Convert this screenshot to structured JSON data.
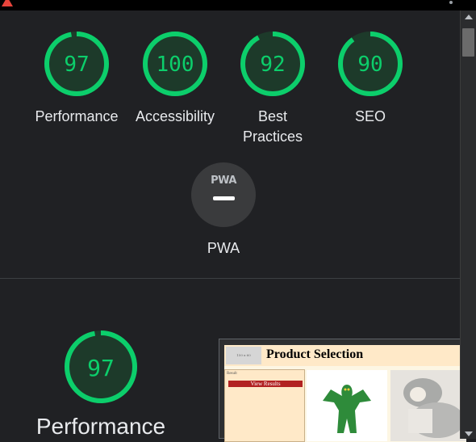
{
  "gauges": [
    {
      "score": "97",
      "label": "Performance",
      "color": "#0cce6b"
    },
    {
      "score": "100",
      "label": "Accessibility",
      "color": "#0cce6b"
    },
    {
      "score": "92",
      "label": "Best Practices",
      "color": "#0cce6b"
    },
    {
      "score": "90",
      "label": "SEO",
      "color": "#0cce6b"
    }
  ],
  "pwa": {
    "badge": "PWA",
    "label": "PWA"
  },
  "performance": {
    "score": "97",
    "label": "Performance"
  },
  "screenshot": {
    "thumb_text": "150 x 60",
    "title": "Product Selection",
    "sidebar_text": "Result",
    "button_label": "View Results"
  },
  "colors": {
    "pass": "#0cce6b",
    "background": "#202124"
  }
}
